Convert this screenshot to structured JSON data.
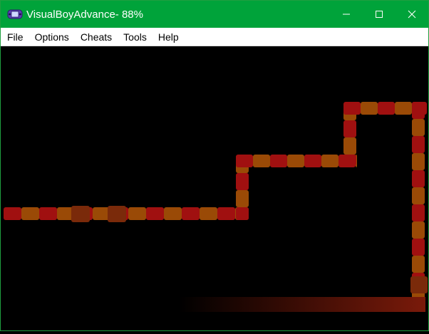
{
  "window": {
    "title": "VisualBoyAdvance- 88%",
    "icon": "gameboy-advance-icon",
    "controls": [
      "minimize-icon",
      "maximize-icon",
      "close-icon"
    ],
    "accent": "#00a33a"
  },
  "menu": {
    "items": [
      {
        "label": "File"
      },
      {
        "label": "Options"
      },
      {
        "label": "Cheats"
      },
      {
        "label": "Tools"
      },
      {
        "label": "Help"
      }
    ]
  },
  "game": {
    "background": "#000000",
    "track_colors": {
      "red": "#a01010",
      "orange": "#9a4a06",
      "dark_red": "#7a1a0a",
      "marker": "#7a2a0a"
    }
  }
}
